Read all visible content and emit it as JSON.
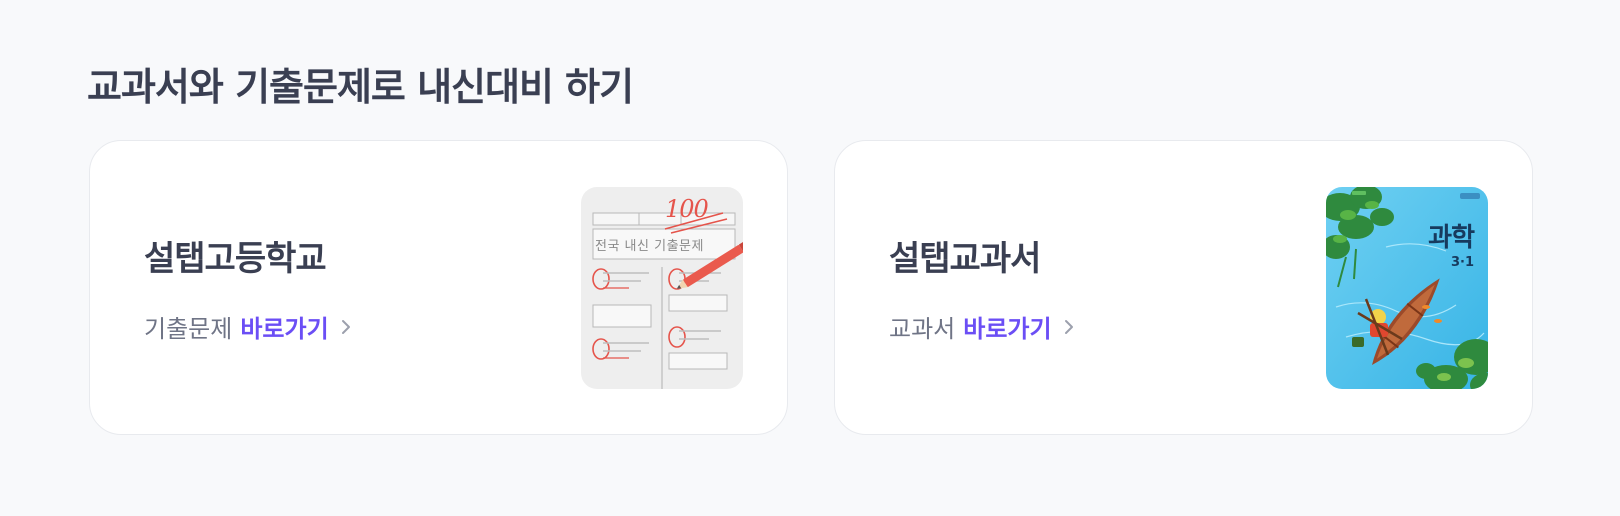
{
  "section": {
    "title": "교과서와 기출문제로 내신대비 하기"
  },
  "cards": [
    {
      "title": "설탭고등학교",
      "link_prefix": "기출문제",
      "link_action": "바로가기",
      "thumbnail": {
        "icon": "exam-paper-icon",
        "label": "전국 내신 기출문제",
        "score": "100"
      }
    },
    {
      "title": "설탭교과서",
      "link_prefix": "교과서",
      "link_action": "바로가기",
      "thumbnail": {
        "icon": "science-textbook-cover-icon",
        "title": "과학",
        "grade": "3·1"
      }
    }
  ],
  "colors": {
    "accent": "#6b4ef5",
    "title": "#3a3f52",
    "muted": "#6f7486",
    "background": "#f8f9fb"
  }
}
